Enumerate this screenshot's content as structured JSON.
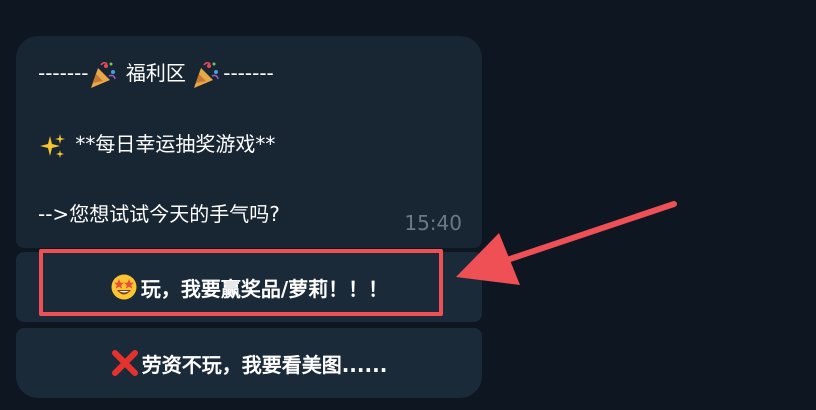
{
  "message": {
    "line1_prefix": "-------",
    "line1_title": " 福利区 ",
    "line1_suffix": "-------",
    "line2_text": " **每日幸运抽奖游戏**",
    "line3_text": "-->您想试试今天的手气吗?",
    "timestamp": "15:40"
  },
  "buttons": [
    {
      "label": "玩，我要赢奖品/萝莉！！！",
      "icon": "star-struck-face-icon"
    },
    {
      "label": "劳资不玩，我要看美图......",
      "icon": "cross-mark-icon"
    }
  ],
  "icons": {
    "party": "party-popper-icon",
    "sparkles": "sparkles-icon"
  },
  "colors": {
    "background": "#0e1621",
    "bubble": "#182533",
    "button": "#1b2a38",
    "highlight": "#ee5055",
    "timestamp": "#6c7883"
  }
}
